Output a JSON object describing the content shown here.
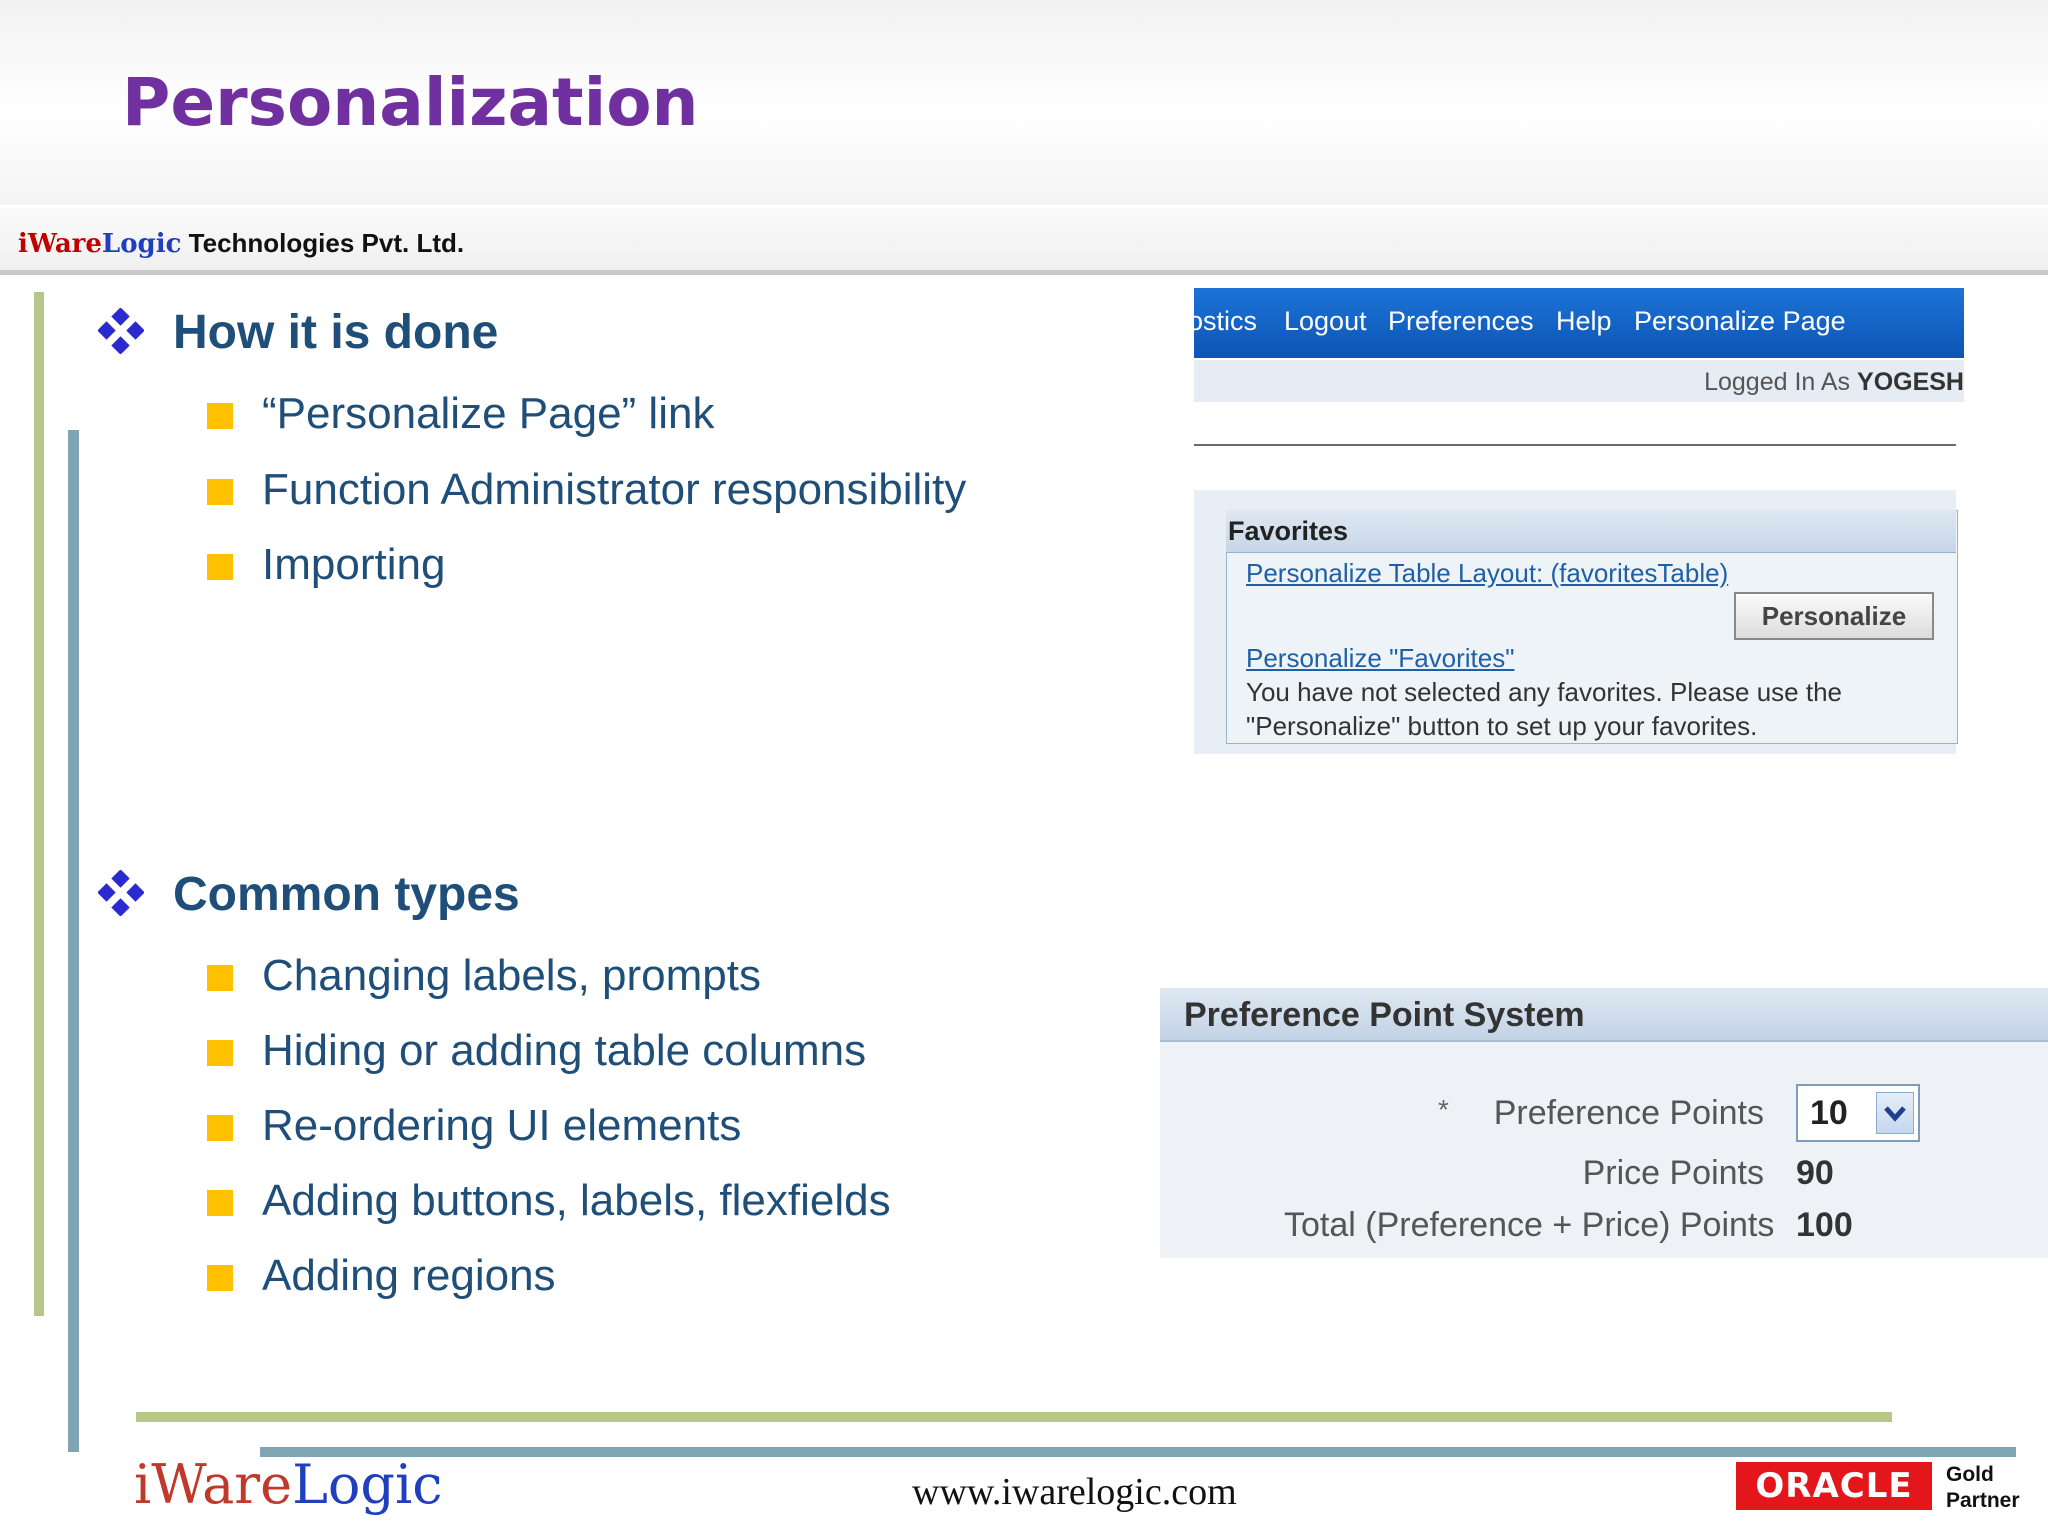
{
  "slide": {
    "title": "Personalization",
    "company": {
      "i": "i",
      "ware": "Ware",
      "logic": "Logic",
      "rest": " Technologies Pvt. Ltd."
    }
  },
  "sections": [
    {
      "heading": "How it is done",
      "items": [
        "“Personalize Page” link",
        "Function Administrator responsibility",
        "Importing"
      ]
    },
    {
      "heading": "Common types",
      "items": [
        "Changing labels, prompts",
        "Hiding or adding table columns",
        "Re-ordering UI elements",
        "Adding buttons, labels, flexfields",
        "Adding regions"
      ]
    }
  ],
  "screenshot_nav": {
    "links": [
      "ostics",
      "Logout",
      "Preferences",
      "Help",
      "Personalize Page"
    ],
    "logged_prefix": "Logged In As",
    "user": "YOGESH"
  },
  "screenshot_favorites": {
    "title": "Favorites",
    "table_link": "Personalize Table Layout: (favoritesTable)",
    "button": "Personalize",
    "region_link": "Personalize \"Favorites\"",
    "message_line1": "You have not selected any favorites. Please use the",
    "message_line2": "\"Personalize\" button to set up your favorites."
  },
  "screenshot_pref": {
    "title": "Preference Point System",
    "required_mark": "*",
    "rows": [
      {
        "label": "Preference Points",
        "value": "10"
      },
      {
        "label": "Price Points",
        "value": "90"
      },
      {
        "label": "Total (Preference + Price) Points",
        "value": "100"
      }
    ]
  },
  "footer": {
    "logo_i": "i",
    "logo_ware": "Ware",
    "logo_logic": "Logic",
    "url": "www.iwarelogic.com",
    "oracle": "ORACLE",
    "partner_line1": "Gold",
    "partner_line2": "Partner"
  },
  "colors": {
    "title": "#7030a0",
    "text": "#1f4e79",
    "bullet": "#ffc000",
    "diamond": "#2a2ad0",
    "accent_green": "#b7c78a",
    "accent_blue": "#7fa5b4",
    "oracle_red": "#e3171b"
  }
}
